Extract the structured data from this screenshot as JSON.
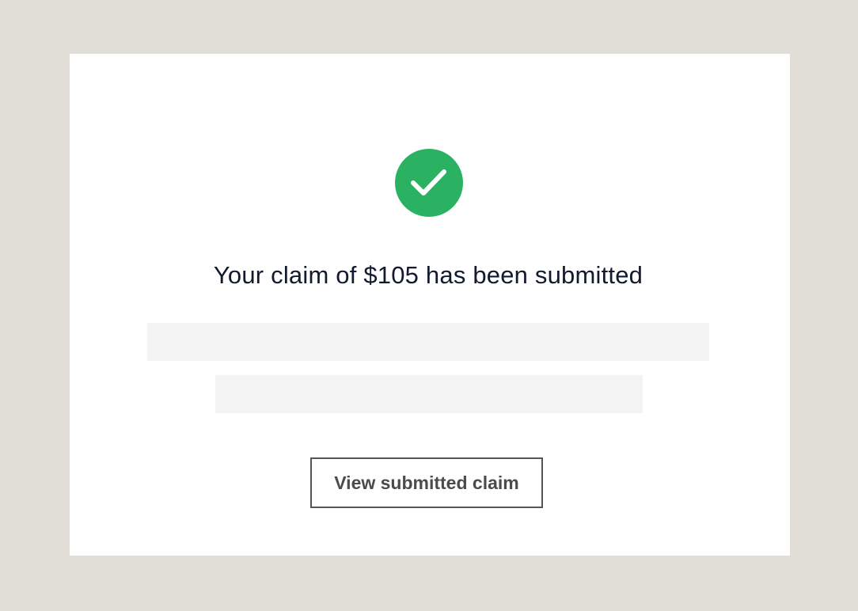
{
  "confirmation": {
    "icon": "check-circle-icon",
    "title": "Your claim of $105 has been submitted",
    "button_label": "View submitted claim",
    "colors": {
      "success": "#2ab262",
      "text": "#111a2e",
      "background": "#e1ded7",
      "placeholder": "#f3f3f3"
    }
  }
}
